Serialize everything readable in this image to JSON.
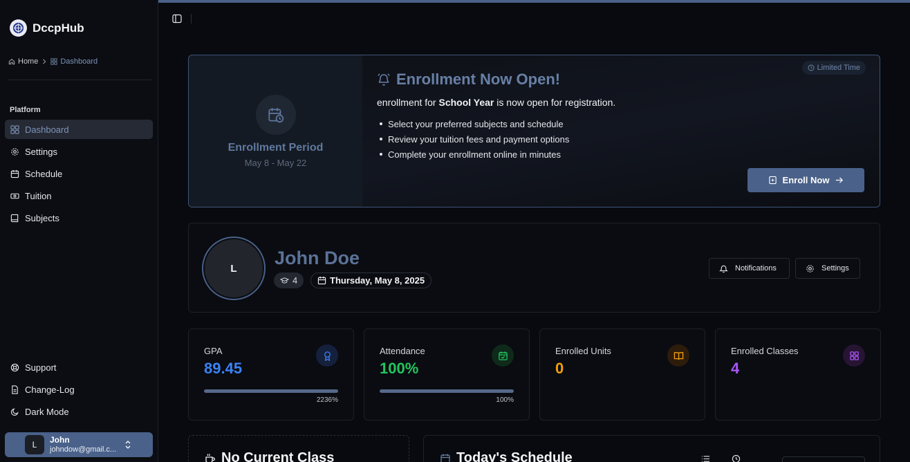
{
  "brand": {
    "name": "DccpHub"
  },
  "breadcrumb": {
    "home": "Home",
    "current": "Dashboard"
  },
  "sidebar": {
    "section_label": "Platform",
    "items": [
      {
        "label": "Dashboard",
        "icon": "dashboard-icon",
        "active": true
      },
      {
        "label": "Settings",
        "icon": "gear-icon"
      },
      {
        "label": "Schedule",
        "icon": "calendar-icon"
      },
      {
        "label": "Tuition",
        "icon": "tuition-icon"
      },
      {
        "label": "Subjects",
        "icon": "book-icon"
      }
    ],
    "bottom_items": [
      {
        "label": "Support",
        "icon": "support-icon"
      },
      {
        "label": "Change-Log",
        "icon": "document-icon"
      },
      {
        "label": "Dark Mode",
        "icon": "moon-icon"
      }
    ]
  },
  "user": {
    "initial": "L",
    "name": "John",
    "email": "johndow@gmail.c..."
  },
  "banner": {
    "period_title": "Enrollment Period",
    "period_dates": "May 8 - May 22",
    "title": "Enrollment Now Open!",
    "desc_prefix": "enrollment for ",
    "desc_bold": "School Year",
    "desc_suffix": " is now open for registration.",
    "bullets": [
      "Select your preferred subjects and schedule",
      "Review your tuition fees and payment options",
      "Complete your enrollment online in minutes"
    ],
    "badge": "Limited Time",
    "cta": "Enroll Now"
  },
  "profile": {
    "initial": "L",
    "name": "John Doe",
    "level": "4",
    "date": "Thursday, May 8, 2025",
    "notifications_label": "Notifications",
    "settings_label": "Settings"
  },
  "stats": [
    {
      "label": "GPA",
      "value": "89.45",
      "color": "#3b82f6",
      "icon": "award-icon",
      "icon_bg": "#15203d",
      "progress": 1.0,
      "progress_label": "2236%"
    },
    {
      "label": "Attendance",
      "value": "100%",
      "color": "#22c55e",
      "icon": "calendar-check-icon",
      "icon_bg": "#0f2a1a",
      "progress": 1.0,
      "progress_label": "100%"
    },
    {
      "label": "Enrolled Units",
      "value": "0",
      "color": "#f59e0b",
      "icon": "open-book-icon",
      "icon_bg": "#2e1c0b"
    },
    {
      "label": "Enrolled Classes",
      "value": "4",
      "color": "#a855f7",
      "icon": "grid-icon",
      "icon_bg": "#271433"
    }
  ],
  "cards": {
    "current_class": "No Current Class",
    "schedule": "Today's Schedule"
  }
}
